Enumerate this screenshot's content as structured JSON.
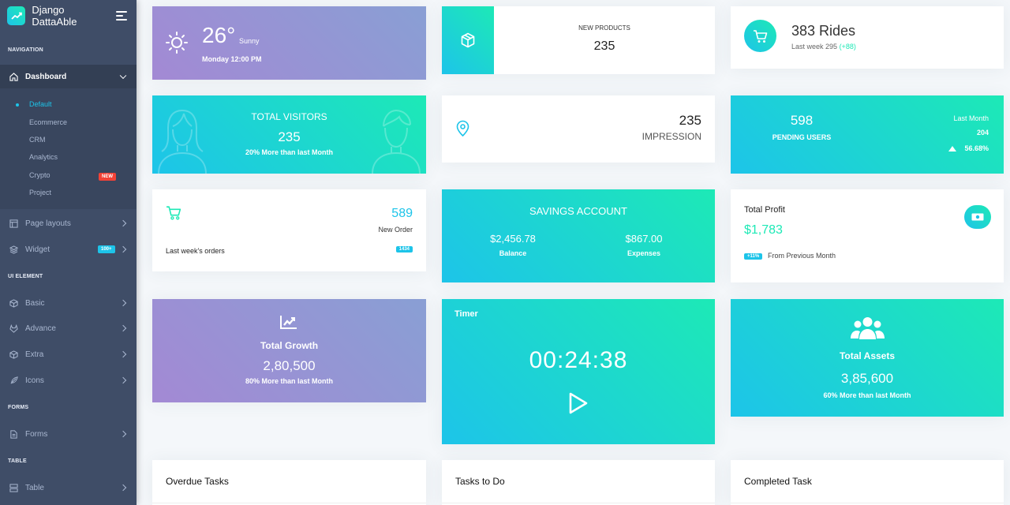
{
  "sidebar": {
    "brand": "Django DattaAble",
    "sections": {
      "navigation": "NAVIGATION",
      "ui_element": "UI ELEMENT",
      "forms": "FORMS",
      "table": "TABLE"
    },
    "dashboard": "Dashboard",
    "sub_items": [
      "Default",
      "Ecommerce",
      "CRM",
      "Analytics",
      "Crypto",
      "Project"
    ],
    "crypto_badge": "NEW",
    "page_layouts": "Page layouts",
    "widget": "Widget",
    "widget_badge": "100+",
    "basic": "Basic",
    "advance": "Advance",
    "extra": "Extra",
    "icons": "Icons",
    "forms": "Forms",
    "table": "Table"
  },
  "weather": {
    "temp": "26°",
    "condition": "Sunny",
    "datetime": "Monday 12:00 PM"
  },
  "products": {
    "label": "NEW PRODUCTS",
    "value": "235"
  },
  "rides": {
    "title": "383 Rides",
    "sub": "Last week 295",
    "delta": "(+88)"
  },
  "visitors": {
    "title": "TOTAL VISITORS",
    "value": "235",
    "sub": "20% More than last Month"
  },
  "impression": {
    "value": "235",
    "label": "IMPRESSION"
  },
  "pending": {
    "value": "598",
    "label": "PENDING USERS",
    "month_label": "Last Month",
    "month_value": "204",
    "percent": "56.68%"
  },
  "orders": {
    "value": "589",
    "label": "New Order",
    "sub": "Last week's orders",
    "badge": "1434"
  },
  "savings": {
    "title": "SAVINGS ACCOUNT",
    "balance": "$2,456.78",
    "balance_label": "Balance",
    "expenses": "$867.00",
    "expenses_label": "Expenses"
  },
  "profit": {
    "title": "Total Profit",
    "value": "$1,783",
    "badge": "+11%",
    "sub": "From Previous Month"
  },
  "growth": {
    "title": "Total Growth",
    "value": "2,80,500",
    "sub": "80% More than last Month"
  },
  "timer": {
    "title": "Timer",
    "time": "00:24:38"
  },
  "assets": {
    "title": "Total Assets",
    "value": "3,85,600",
    "sub": "60% More than last Month"
  },
  "tasks": {
    "overdue": "Overdue Tasks",
    "todo": "Tasks to Do",
    "completed": "Completed Task"
  },
  "colors": {
    "sidebar": "#3f4d67",
    "accent": "#1dc4e9",
    "green": "#1de9b6",
    "purple": "#a389d4",
    "badge_red": "#f44236",
    "badge_blue": "#1dc4e9"
  }
}
